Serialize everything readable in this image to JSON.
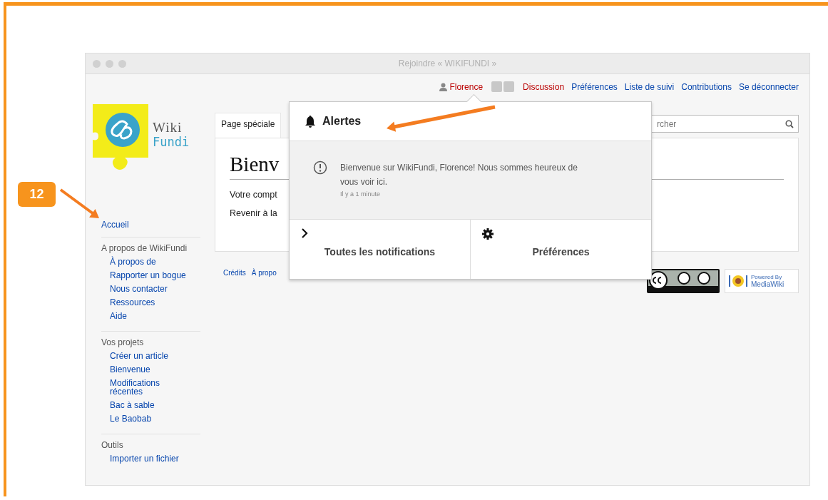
{
  "annotation": {
    "badge": "12"
  },
  "window": {
    "title": "Rejoindre « WIKIFUNDI »"
  },
  "personal_tools": {
    "user": "Florence",
    "user_exists": false,
    "links": [
      {
        "label": "Discussion",
        "exists": false
      },
      {
        "label": "Préférences",
        "exists": true
      },
      {
        "label": "Liste de suivi",
        "exists": true
      },
      {
        "label": "Contributions",
        "exists": true
      },
      {
        "label": "Se déconnecter",
        "exists": true
      }
    ]
  },
  "logo": {
    "line1": "Wiki",
    "line2": "Fundi"
  },
  "sidebar": {
    "top": "Accueil",
    "sections": [
      {
        "heading": "A propos de WikiFundi",
        "items": [
          "À propos de",
          "Rapporter un bogue",
          "Nous contacter",
          "Ressources",
          "Aide"
        ]
      },
      {
        "heading": "Vos projets",
        "items": [
          "Créer un article",
          "Bienvenue",
          "Modifications récentes",
          "Bac à sable",
          "Le Baobab"
        ]
      },
      {
        "heading": "Outils",
        "items": [
          "Importer un fichier"
        ]
      }
    ]
  },
  "content": {
    "tab": "Page spéciale",
    "heading": "Bienv",
    "lines": [
      "Votre compt",
      "Revenir à la"
    ],
    "search": {
      "placeholder": "rcher"
    }
  },
  "footer": {
    "links": [
      "Crédits",
      "À propo"
    ],
    "powered_by": {
      "line1": "Powered By",
      "line2": "MediaWiki"
    }
  },
  "popup": {
    "title": "Alertes",
    "notifications": [
      {
        "text": "Bienvenue sur WikiFundi, Florence! Nous sommes heureux de vous voir ici.",
        "time": "Il y a 1 minute"
      }
    ],
    "actions": [
      {
        "kind": "all",
        "label": "Toutes les notifications"
      },
      {
        "kind": "settings",
        "label": "Préférences"
      }
    ]
  }
}
